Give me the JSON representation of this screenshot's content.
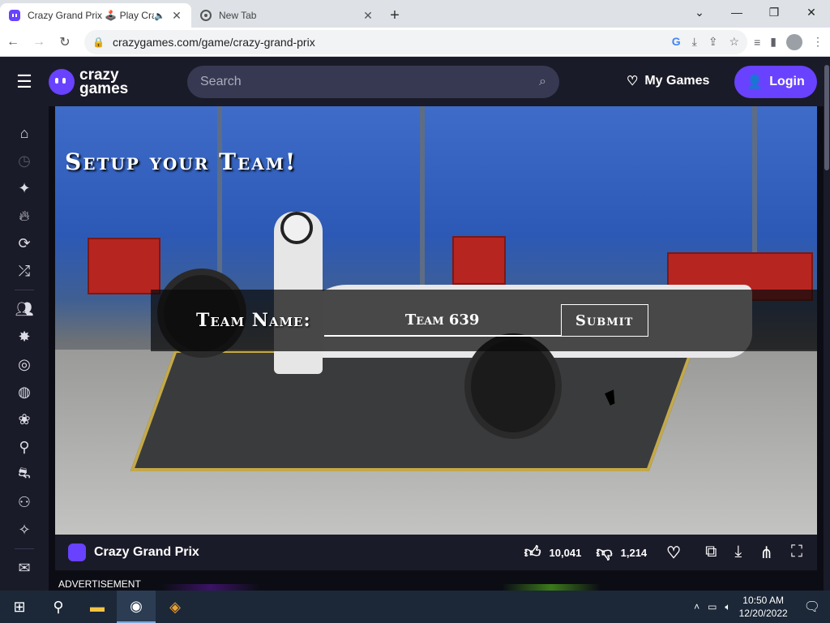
{
  "browser": {
    "tabs": [
      {
        "title": "Crazy Grand Prix 🕹️ Play Cra",
        "active": true
      },
      {
        "title": "New Tab",
        "active": false
      }
    ],
    "url": "crazygames.com/game/crazy-grand-prix"
  },
  "site": {
    "logo_line1": "crazy",
    "logo_line2": "games",
    "search_placeholder": "Search",
    "my_games_label": "My Games",
    "login_label": "Login"
  },
  "game": {
    "setup_title": "Setup your Team!",
    "team_name_label": "Team Name:",
    "team_name_value": "Team 639",
    "submit_label": "Submit"
  },
  "gamebar": {
    "name": "Crazy Grand Prix",
    "likes": "10,041",
    "dislikes": "1,214"
  },
  "advertisement_label": "ADVERTISEMENT",
  "taskbar": {
    "time": "10:50 AM",
    "date": "12/20/2022"
  },
  "colors": {
    "brand": "#6842ff",
    "header_bg": "#1a1b28",
    "search_bg": "#373952"
  }
}
